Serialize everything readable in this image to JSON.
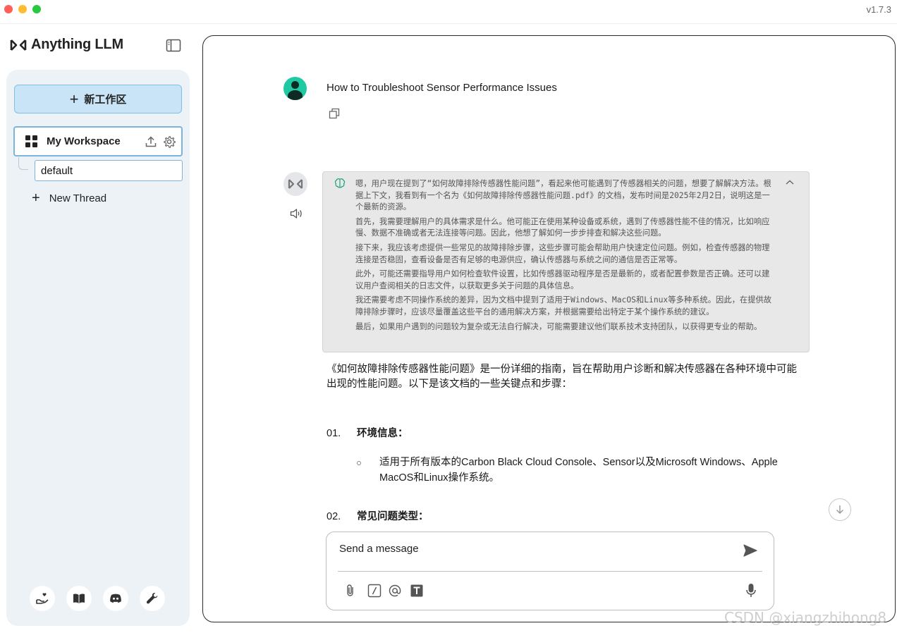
{
  "window": {
    "version": "v1.7.3"
  },
  "sidebar": {
    "app_name": "Anything LLM",
    "new_workspace_label": "新工作区",
    "workspace_name": "My Workspace",
    "thread_default": "default",
    "new_thread_label": "New Thread"
  },
  "chat": {
    "user_question": "How to Troubleshoot Sensor Performance Issues",
    "thoughts": [
      "嗯，用户现在提到了“如何故障排除传感器性能问题”，看起来他可能遇到了传感器相关的问题，想要了解解决方法。根据上下文，我看到有一个名为《如何故障排除传感器性能问题.pdf》的文档，发布时间是2025年2月2日，说明这是一个最新的资源。",
      "首先，我需要理解用户的具体需求是什么。他可能正在使用某种设备或系统，遇到了传感器性能不佳的情况，比如响应慢、数据不准确或者无法连接等问题。因此，他想了解如何一步步排查和解决这些问题。",
      "接下来，我应该考虑提供一些常见的故障排除步骤，这些步骤可能会帮助用户快速定位问题。例如，检查传感器的物理连接是否稳固，查看设备是否有足够的电源供应，确认传感器与系统之间的通信是否正常等。",
      "此外，可能还需要指导用户如何检查软件设置，比如传感器驱动程序是否是最新的，或者配置参数是否正确。还可以建议用户查阅相关的日志文件，以获取更多关于问题的具体信息。",
      "我还需要考虑不同操作系统的差异，因为文档中提到了适用于Windows、MacOS和Linux等多种系统。因此，在提供故障排除步骤时，应该尽量覆盖这些平台的通用解决方案，并根据需要给出特定于某个操作系统的建议。",
      "最后，如果用户遇到的问题较为复杂或无法自行解决，可能需要建议他们联系技术支持团队，以获得更专业的帮助。"
    ],
    "answer_intro": "《如何故障排除传感器性能问题》是一份详细的指南，旨在帮助用户诊断和解决传感器在各种环境中可能出现的性能问题。以下是该文档的一些关键点和步骤：",
    "section1_num": "01.",
    "section1_title": "环境信息：",
    "section1_bullet": "适用于所有版本的Carbon Black Cloud Console、Sensor以及Microsoft Windows、Apple MacOS和Linux操作系统。",
    "section2_num": "02.",
    "section2_title": "常见问题类型："
  },
  "composer": {
    "placeholder": "Send a message"
  },
  "watermark": "CSDN @xiangzhihong8",
  "colors": {
    "accent": "#7cc0ea",
    "new_ws_bg": "#c9e4f7",
    "sidebar_bg": "#edf2f7",
    "user_avatar": "#1fc9a4"
  }
}
